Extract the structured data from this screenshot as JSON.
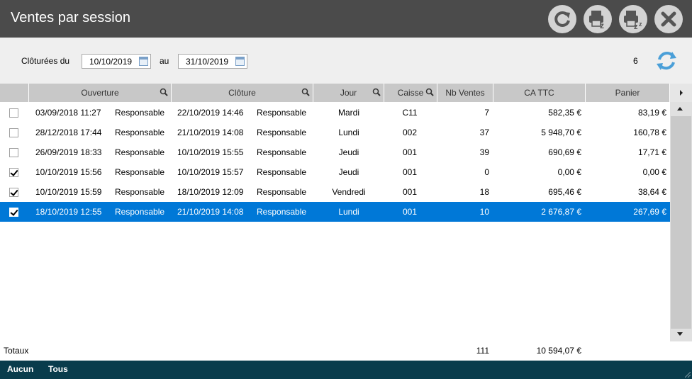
{
  "window": {
    "title": "Ventes par session"
  },
  "title_buttons": [
    {
      "name": "refresh-button",
      "icon": "refresh-icon"
    },
    {
      "name": "z-report-button",
      "icon": "printer-z-icon"
    },
    {
      "name": "zz-report-button",
      "icon": "printer-zz-icon"
    },
    {
      "name": "close-button",
      "icon": "close-icon"
    }
  ],
  "filter": {
    "label_from": "Clôturées du",
    "date_from": "10/10/2019",
    "label_to": "au",
    "date_to": "31/10/2019",
    "count": "6"
  },
  "columns": [
    "Ouverture",
    "Clôture",
    "Jour",
    "Caisse",
    "Nb Ventes",
    "CA TTC",
    "Panier"
  ],
  "rows": [
    {
      "checked": false,
      "open_date": "03/09/2018 11:27",
      "open_user": "Responsable",
      "close_date": "22/10/2019 14:46",
      "close_user": "Responsable",
      "day": "Mardi",
      "register": "C11",
      "sales": "7",
      "ca": "582,35 €",
      "basket": "83,19 €",
      "selected": false
    },
    {
      "checked": false,
      "open_date": "28/12/2018 17:44",
      "open_user": "Responsable",
      "close_date": "21/10/2019 14:08",
      "close_user": "Responsable",
      "day": "Lundi",
      "register": "002",
      "sales": "37",
      "ca": "5 948,70 €",
      "basket": "160,78 €",
      "selected": false
    },
    {
      "checked": false,
      "open_date": "26/09/2019 18:33",
      "open_user": "Responsable",
      "close_date": "10/10/2019 15:55",
      "close_user": "Responsable",
      "day": "Jeudi",
      "register": "001",
      "sales": "39",
      "ca": "690,69 €",
      "basket": "17,71 €",
      "selected": false
    },
    {
      "checked": true,
      "open_date": "10/10/2019 15:56",
      "open_user": "Responsable",
      "close_date": "10/10/2019 15:57",
      "close_user": "Responsable",
      "day": "Jeudi",
      "register": "001",
      "sales": "0",
      "ca": "0,00 €",
      "basket": "0,00 €",
      "selected": false
    },
    {
      "checked": true,
      "open_date": "10/10/2019 15:59",
      "open_user": "Responsable",
      "close_date": "18/10/2019 12:09",
      "close_user": "Responsable",
      "day": "Vendredi",
      "register": "001",
      "sales": "18",
      "ca": "695,46 €",
      "basket": "38,64 €",
      "selected": false
    },
    {
      "checked": true,
      "open_date": "18/10/2019 12:55",
      "open_user": "Responsable",
      "close_date": "21/10/2019 14:08",
      "close_user": "Responsable",
      "day": "Lundi",
      "register": "001",
      "sales": "10",
      "ca": "2 676,87 €",
      "basket": "267,69 €",
      "selected": true
    }
  ],
  "totals": {
    "label": "Totaux",
    "sales": "111",
    "ca": "10 594,07 €"
  },
  "footer": {
    "none_label": "Aucun",
    "all_label": "Tous"
  },
  "colors": {
    "titlebar": "#4b4b4b",
    "selection": "#0078d7",
    "footer": "#093c4c",
    "refresh_accent": "#4a9fd8"
  }
}
